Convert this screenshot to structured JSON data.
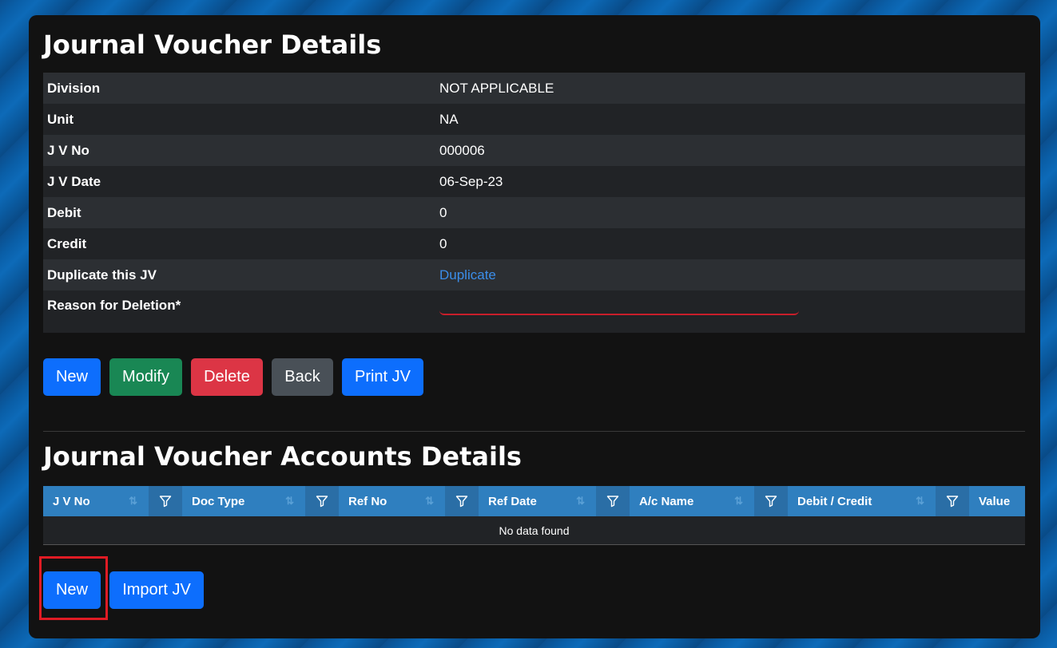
{
  "voucher_details": {
    "title": "Journal Voucher Details",
    "rows": [
      {
        "label": "Division",
        "value": "NOT APPLICABLE"
      },
      {
        "label": "Unit",
        "value": "NA"
      },
      {
        "label": "J V No",
        "value": "000006"
      },
      {
        "label": "J V Date",
        "value": "06-Sep-23"
      },
      {
        "label": "Debit",
        "value": "0"
      },
      {
        "label": "Credit",
        "value": "0"
      },
      {
        "label": "Duplicate this JV",
        "value": "Duplicate"
      },
      {
        "label": "Reason for Deletion*",
        "value": ""
      }
    ],
    "buttons": {
      "new": "New",
      "modify": "Modify",
      "delete": "Delete",
      "back": "Back",
      "print": "Print JV"
    }
  },
  "accounts_details": {
    "title": "Journal Voucher Accounts Details",
    "columns": [
      "J V No",
      "Doc Type",
      "Ref No",
      "Ref Date",
      "A/c Name",
      "Debit / Credit",
      "Value"
    ],
    "empty_message": "No data found",
    "buttons": {
      "new": "New",
      "import": "Import JV"
    }
  },
  "colors": {
    "primary": "#0d6efd",
    "success": "#198754",
    "danger": "#dc3545",
    "secondary": "#495057",
    "grid_header": "#2f7fbf",
    "link": "#3b8eea",
    "highlight": "#e01b24"
  }
}
